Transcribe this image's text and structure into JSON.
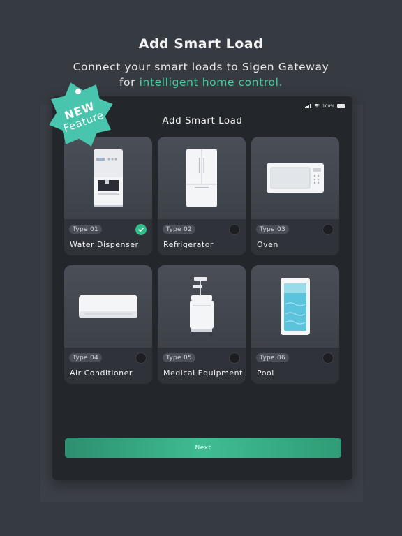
{
  "header": {
    "title": "Add Smart Load",
    "subtitle_line1": "Connect your smart loads to Sigen Gateway",
    "subtitle_line2_prefix": "for ",
    "subtitle_line2_accent": "intelligent home control."
  },
  "badge": {
    "line1": "NEW",
    "line2": "Feature"
  },
  "device": {
    "status_battery": "100%",
    "screen_title": "Add Smart Load",
    "cards": [
      {
        "type": "Type 01",
        "label": "Water Dispenser",
        "selected": true,
        "icon": "water-dispenser-icon"
      },
      {
        "type": "Type 02",
        "label": "Refrigerator",
        "selected": false,
        "icon": "refrigerator-icon"
      },
      {
        "type": "Type 03",
        "label": "Oven",
        "selected": false,
        "icon": "oven-icon"
      },
      {
        "type": "Type 04",
        "label": "Air Conditioner",
        "selected": false,
        "icon": "air-conditioner-icon"
      },
      {
        "type": "Type 05",
        "label": "Medical Equipment",
        "selected": false,
        "icon": "medical-equipment-icon"
      },
      {
        "type": "Type 06",
        "label": "Pool",
        "selected": false,
        "icon": "pool-icon"
      }
    ],
    "next_label": "Next"
  },
  "colors": {
    "accent": "#3fd1a5",
    "selected": "#2fbf8a",
    "background": "#363a41",
    "device_bg": "#23262b"
  }
}
